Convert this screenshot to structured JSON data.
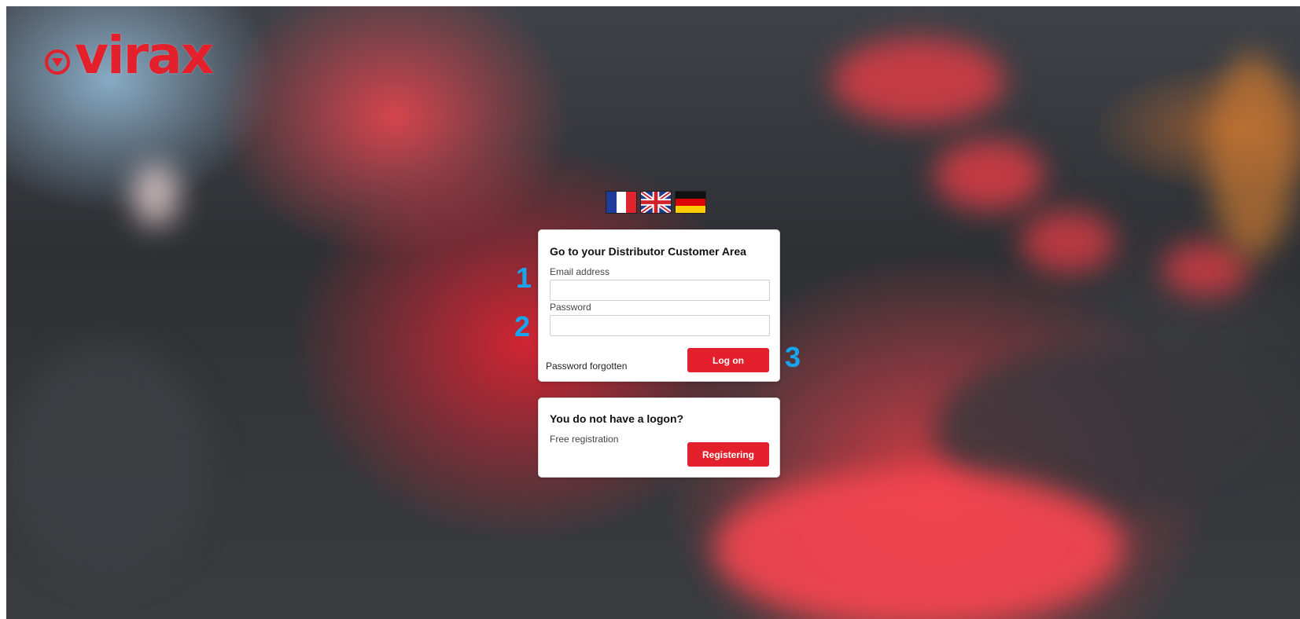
{
  "brand": {
    "name": "virax",
    "color": "#e3202c"
  },
  "languages": [
    {
      "code": "fr",
      "icon": "flag-france-icon"
    },
    {
      "code": "en",
      "icon": "flag-uk-icon"
    },
    {
      "code": "de",
      "icon": "flag-germany-icon"
    }
  ],
  "login": {
    "title": "Go to your Distributor Customer Area",
    "email_label": "Email address",
    "email_value": "",
    "password_label": "Password",
    "password_value": "",
    "forgot_label": "Password forgotten",
    "submit_label": "Log on"
  },
  "register": {
    "title": "You do not have a logon?",
    "subtitle": "Free registration",
    "button_label": "Registering"
  },
  "annotations": {
    "marker_1": "1",
    "marker_2": "2",
    "marker_3": "3",
    "color": "#16a6f0"
  }
}
